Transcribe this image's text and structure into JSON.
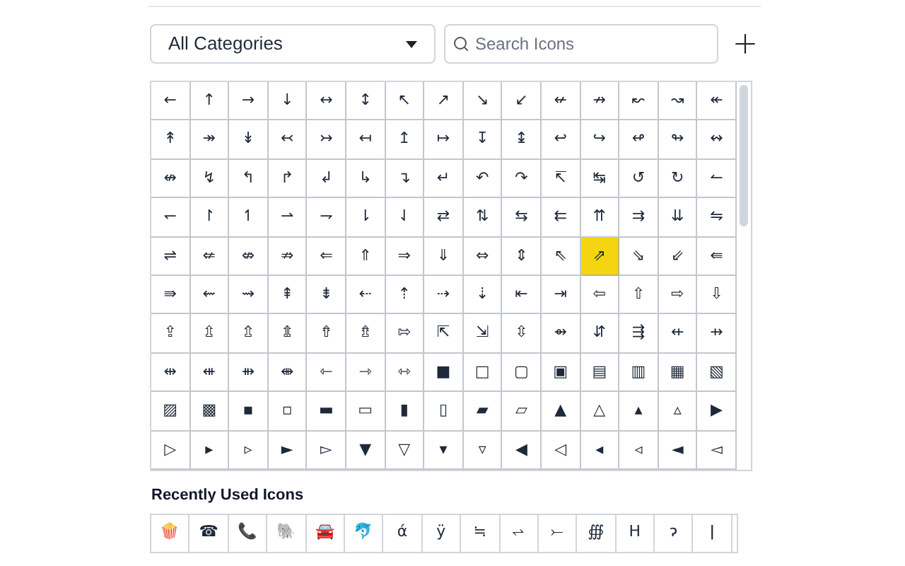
{
  "category_select": {
    "value": "All Categories"
  },
  "search": {
    "placeholder": "Search Icons"
  },
  "icons": [
    {
      "glyph": "←",
      "selected": false
    },
    {
      "glyph": "↑",
      "selected": false
    },
    {
      "glyph": "→",
      "selected": false
    },
    {
      "glyph": "↓",
      "selected": false
    },
    {
      "glyph": "↔",
      "selected": false
    },
    {
      "glyph": "↕",
      "selected": false
    },
    {
      "glyph": "↖",
      "selected": false
    },
    {
      "glyph": "↗",
      "selected": false
    },
    {
      "glyph": "↘",
      "selected": false
    },
    {
      "glyph": "↙",
      "selected": false
    },
    {
      "glyph": "↚",
      "selected": false
    },
    {
      "glyph": "↛",
      "selected": false
    },
    {
      "glyph": "↜",
      "selected": false
    },
    {
      "glyph": "↝",
      "selected": false
    },
    {
      "glyph": "↞",
      "selected": false
    },
    {
      "glyph": "↟",
      "selected": false
    },
    {
      "glyph": "↠",
      "selected": false
    },
    {
      "glyph": "↡",
      "selected": false
    },
    {
      "glyph": "↢",
      "selected": false
    },
    {
      "glyph": "↣",
      "selected": false
    },
    {
      "glyph": "↤",
      "selected": false
    },
    {
      "glyph": "↥",
      "selected": false
    },
    {
      "glyph": "↦",
      "selected": false
    },
    {
      "glyph": "↧",
      "selected": false
    },
    {
      "glyph": "↨",
      "selected": false
    },
    {
      "glyph": "↩",
      "selected": false
    },
    {
      "glyph": "↪",
      "selected": false
    },
    {
      "glyph": "↫",
      "selected": false
    },
    {
      "glyph": "↬",
      "selected": false
    },
    {
      "glyph": "↭",
      "selected": false
    },
    {
      "glyph": "↮",
      "selected": false
    },
    {
      "glyph": "↯",
      "selected": false
    },
    {
      "glyph": "↰",
      "selected": false
    },
    {
      "glyph": "↱",
      "selected": false
    },
    {
      "glyph": "↲",
      "selected": false
    },
    {
      "glyph": "↳",
      "selected": false
    },
    {
      "glyph": "↴",
      "selected": false
    },
    {
      "glyph": "↵",
      "selected": false
    },
    {
      "glyph": "↶",
      "selected": false
    },
    {
      "glyph": "↷",
      "selected": false
    },
    {
      "glyph": "↸",
      "selected": false
    },
    {
      "glyph": "↹",
      "selected": false
    },
    {
      "glyph": "↺",
      "selected": false
    },
    {
      "glyph": "↻",
      "selected": false
    },
    {
      "glyph": "↼",
      "selected": false
    },
    {
      "glyph": "↽",
      "selected": false
    },
    {
      "glyph": "↾",
      "selected": false
    },
    {
      "glyph": "↿",
      "selected": false
    },
    {
      "glyph": "⇀",
      "selected": false
    },
    {
      "glyph": "⇁",
      "selected": false
    },
    {
      "glyph": "⇂",
      "selected": false
    },
    {
      "glyph": "⇃",
      "selected": false
    },
    {
      "glyph": "⇄",
      "selected": false
    },
    {
      "glyph": "⇅",
      "selected": false
    },
    {
      "glyph": "⇆",
      "selected": false
    },
    {
      "glyph": "⇇",
      "selected": false
    },
    {
      "glyph": "⇈",
      "selected": false
    },
    {
      "glyph": "⇉",
      "selected": false
    },
    {
      "glyph": "⇊",
      "selected": false
    },
    {
      "glyph": "⇋",
      "selected": false
    },
    {
      "glyph": "⇌",
      "selected": false
    },
    {
      "glyph": "⇍",
      "selected": false
    },
    {
      "glyph": "⇎",
      "selected": false
    },
    {
      "glyph": "⇏",
      "selected": false
    },
    {
      "glyph": "⇐",
      "selected": false
    },
    {
      "glyph": "⇑",
      "selected": false
    },
    {
      "glyph": "⇒",
      "selected": false
    },
    {
      "glyph": "⇓",
      "selected": false
    },
    {
      "glyph": "⇔",
      "selected": false
    },
    {
      "glyph": "⇕",
      "selected": false
    },
    {
      "glyph": "⇖",
      "selected": false
    },
    {
      "glyph": "⇗",
      "selected": true
    },
    {
      "glyph": "⇘",
      "selected": false
    },
    {
      "glyph": "⇙",
      "selected": false
    },
    {
      "glyph": "⇚",
      "selected": false
    },
    {
      "glyph": "⇛",
      "selected": false
    },
    {
      "glyph": "⇜",
      "selected": false
    },
    {
      "glyph": "⇝",
      "selected": false
    },
    {
      "glyph": "⇞",
      "selected": false
    },
    {
      "glyph": "⇟",
      "selected": false
    },
    {
      "glyph": "⇠",
      "selected": false
    },
    {
      "glyph": "⇡",
      "selected": false
    },
    {
      "glyph": "⇢",
      "selected": false
    },
    {
      "glyph": "⇣",
      "selected": false
    },
    {
      "glyph": "⇤",
      "selected": false
    },
    {
      "glyph": "⇥",
      "selected": false
    },
    {
      "glyph": "⇦",
      "selected": false
    },
    {
      "glyph": "⇧",
      "selected": false
    },
    {
      "glyph": "⇨",
      "selected": false
    },
    {
      "glyph": "⇩",
      "selected": false
    },
    {
      "glyph": "⇪",
      "selected": false
    },
    {
      "glyph": "⇫",
      "selected": false
    },
    {
      "glyph": "⇬",
      "selected": false
    },
    {
      "glyph": "⇭",
      "selected": false
    },
    {
      "glyph": "⇮",
      "selected": false
    },
    {
      "glyph": "⇯",
      "selected": false
    },
    {
      "glyph": "⇰",
      "selected": false
    },
    {
      "glyph": "⇱",
      "selected": false
    },
    {
      "glyph": "⇲",
      "selected": false
    },
    {
      "glyph": "⇳",
      "selected": false
    },
    {
      "glyph": "⇴",
      "selected": false
    },
    {
      "glyph": "⇵",
      "selected": false
    },
    {
      "glyph": "⇶",
      "selected": false
    },
    {
      "glyph": "⇷",
      "selected": false
    },
    {
      "glyph": "⇸",
      "selected": false
    },
    {
      "glyph": "⇹",
      "selected": false
    },
    {
      "glyph": "⇺",
      "selected": false
    },
    {
      "glyph": "⇻",
      "selected": false
    },
    {
      "glyph": "⇼",
      "selected": false
    },
    {
      "glyph": "⇽",
      "selected": false
    },
    {
      "glyph": "⇾",
      "selected": false
    },
    {
      "glyph": "⇿",
      "selected": false
    },
    {
      "glyph": "■",
      "selected": false
    },
    {
      "glyph": "□",
      "selected": false
    },
    {
      "glyph": "▢",
      "selected": false
    },
    {
      "glyph": "▣",
      "selected": false
    },
    {
      "glyph": "▤",
      "selected": false
    },
    {
      "glyph": "▥",
      "selected": false
    },
    {
      "glyph": "▦",
      "selected": false
    },
    {
      "glyph": "▧",
      "selected": false
    },
    {
      "glyph": "▨",
      "selected": false
    },
    {
      "glyph": "▩",
      "selected": false
    },
    {
      "glyph": "▪",
      "selected": false
    },
    {
      "glyph": "▫",
      "selected": false
    },
    {
      "glyph": "▬",
      "selected": false
    },
    {
      "glyph": "▭",
      "selected": false
    },
    {
      "glyph": "▮",
      "selected": false
    },
    {
      "glyph": "▯",
      "selected": false
    },
    {
      "glyph": "▰",
      "selected": false
    },
    {
      "glyph": "▱",
      "selected": false
    },
    {
      "glyph": "▲",
      "selected": false
    },
    {
      "glyph": "△",
      "selected": false
    },
    {
      "glyph": "▴",
      "selected": false
    },
    {
      "glyph": "▵",
      "selected": false
    },
    {
      "glyph": "▶",
      "selected": false
    },
    {
      "glyph": "▷",
      "selected": false
    },
    {
      "glyph": "▸",
      "selected": false
    },
    {
      "glyph": "▹",
      "selected": false
    },
    {
      "glyph": "►",
      "selected": false
    },
    {
      "glyph": "▻",
      "selected": false
    },
    {
      "glyph": "▼",
      "selected": false
    },
    {
      "glyph": "▽",
      "selected": false
    },
    {
      "glyph": "▾",
      "selected": false
    },
    {
      "glyph": "▿",
      "selected": false
    },
    {
      "glyph": "◀",
      "selected": false
    },
    {
      "glyph": "◁",
      "selected": false
    },
    {
      "glyph": "◂",
      "selected": false
    },
    {
      "glyph": "◃",
      "selected": false
    },
    {
      "glyph": "◄",
      "selected": false
    },
    {
      "glyph": "◅",
      "selected": false
    }
  ],
  "recent": {
    "title": "Recently Used Icons",
    "items": [
      "🍿",
      "☎",
      "📞",
      "🐘",
      "🚘",
      "🐬",
      "ά",
      "ÿ",
      "≒",
      "⥋",
      "⤚",
      "∰",
      "H",
      "ɂ",
      "ǀ"
    ]
  }
}
